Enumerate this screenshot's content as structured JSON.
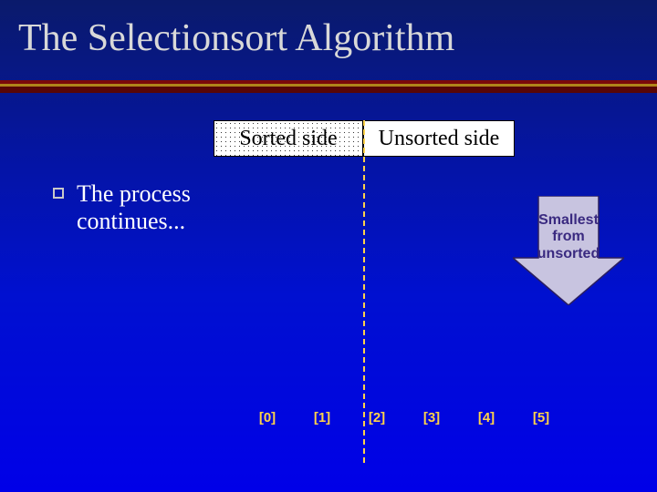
{
  "title": "The Selectionsort Algorithm",
  "labels": {
    "sorted": "Sorted side",
    "unsorted": "Unsorted side"
  },
  "bullet": {
    "line1": "The process",
    "line2": "continues..."
  },
  "arrow": {
    "line1": "Smallest",
    "line2": "from",
    "line3": "unsorted"
  },
  "indices": [
    "[0]",
    "[1]",
    "[2]",
    "[3]",
    "[4]",
    "[5]"
  ],
  "colors": {
    "accent": "#ffd24a",
    "arrow_fill": "#c8c4e0"
  }
}
